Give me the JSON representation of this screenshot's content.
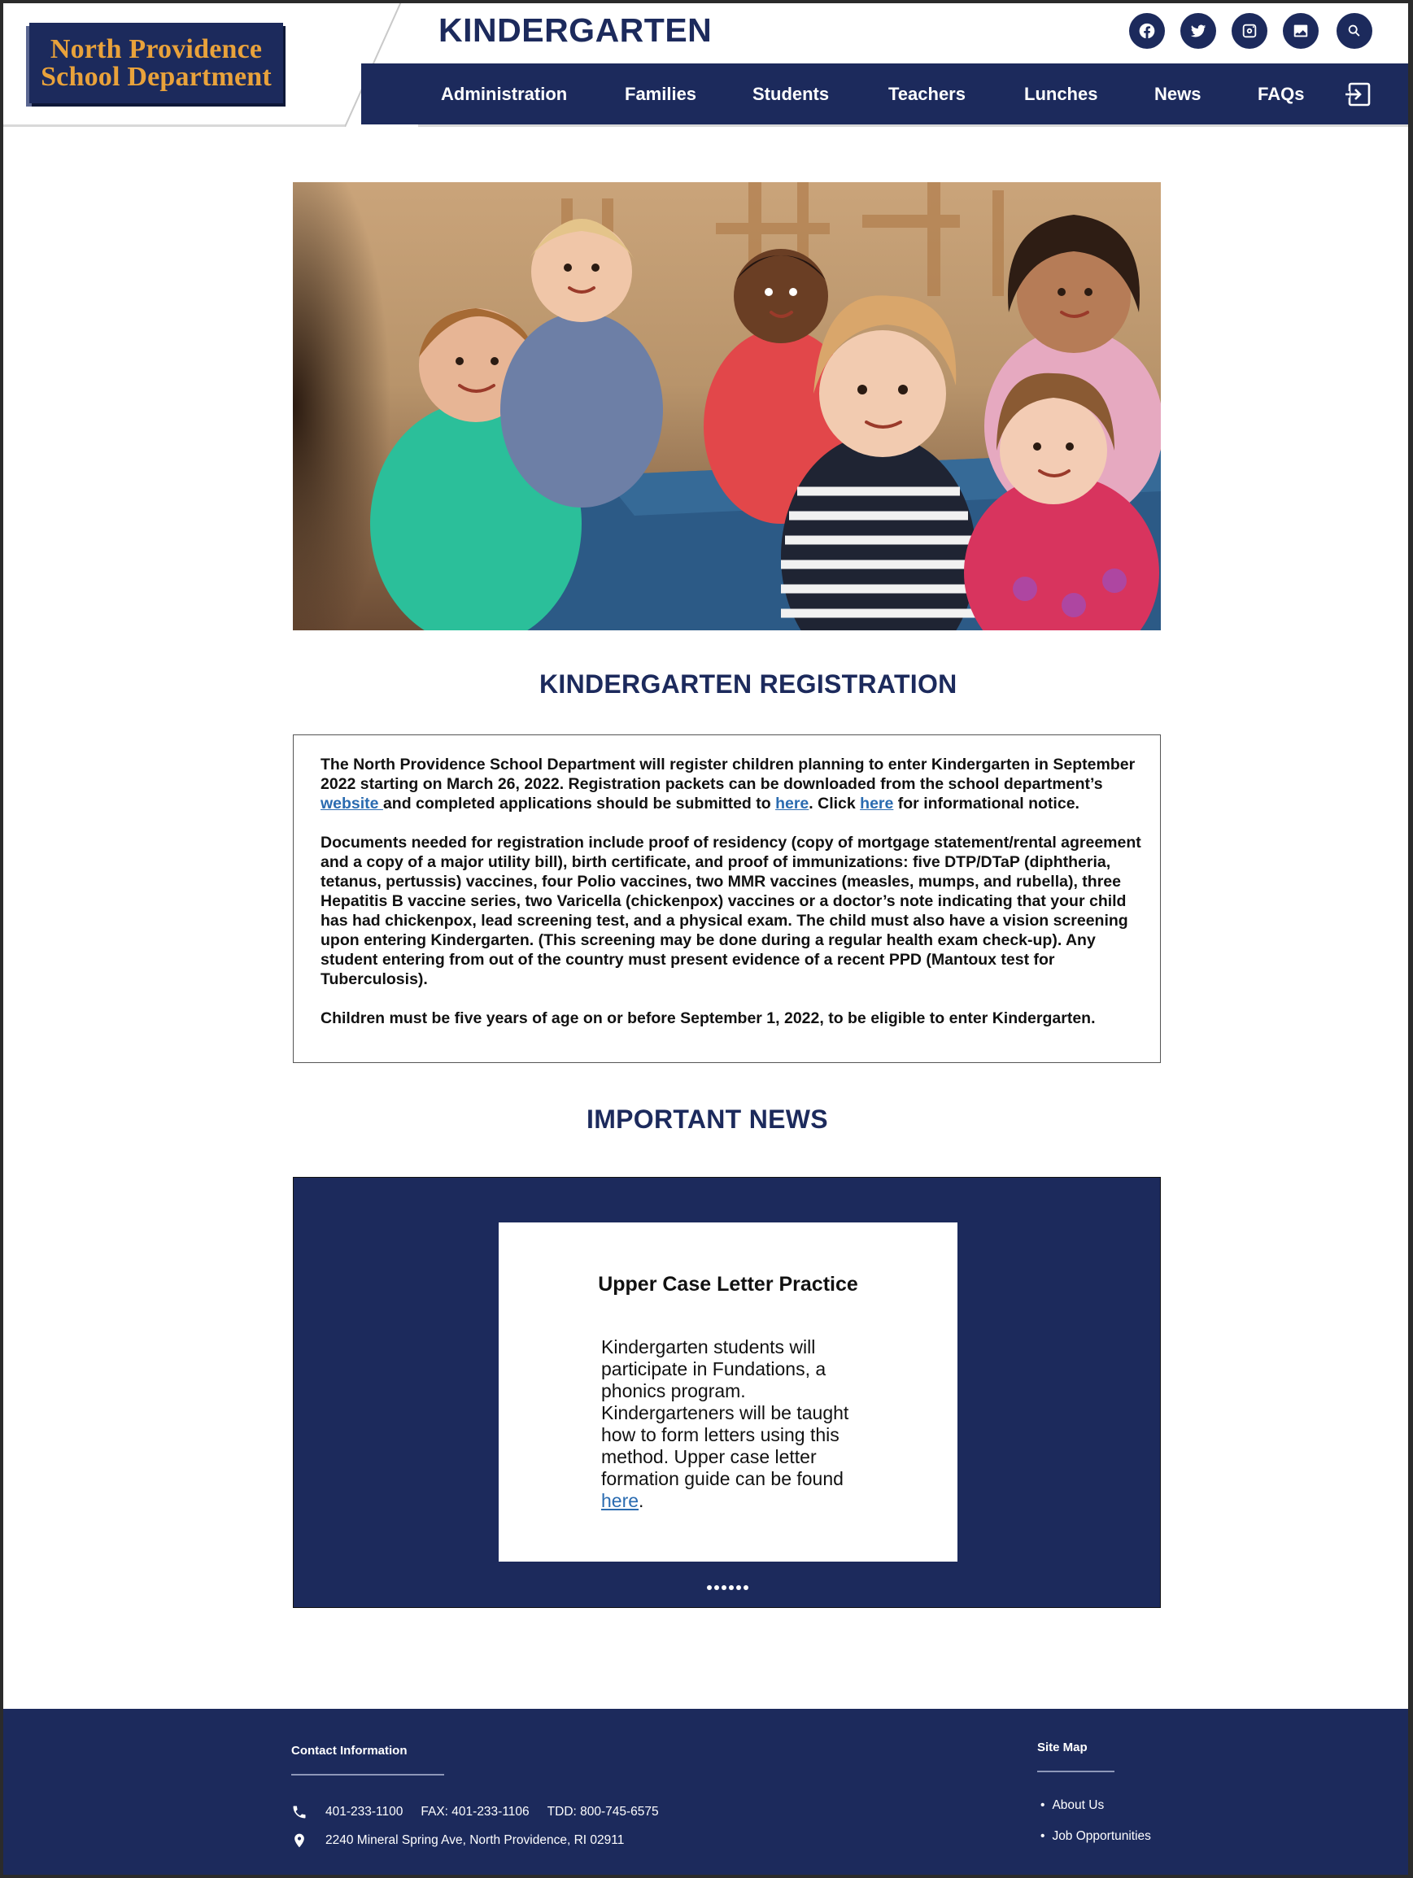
{
  "site": {
    "logo_line1": "North Providence",
    "logo_line2": "School Department",
    "page_title": "KINDERGARTEN",
    "brand_color": "#1c2a5c",
    "accent_color": "#e9a23b",
    "social_icons": [
      "facebook-icon",
      "twitter-icon",
      "instagram-icon",
      "gallery-icon",
      "search-icon"
    ]
  },
  "nav": {
    "items": [
      "Administration",
      "Families",
      "Students",
      "Teachers",
      "Lunches",
      "News",
      "FAQs"
    ],
    "exit_icon": "sign-in-icon"
  },
  "registration": {
    "title": "KINDERGARTEN REGISTRATION",
    "p1_a": "The North Providence School Department will register children planning to enter Kindergarten in September 2022 starting on March 26, 2022. Registration packets can be downloaded from the school department’s ",
    "p1_link1": "website ",
    "p1_b": " and completed applications should be submitted to ",
    "p1_link2": "here",
    "p1_c": ". Click ",
    "p1_link3": "here",
    "p1_d": " for informational notice.",
    "p2": "Documents needed for registration include proof of residency (copy of mortgage statement/rental agreement and a copy of a major utility bill), birth certificate, and proof of immunizations: five DTP/DTaP (diphtheria, tetanus, pertussis) vaccines, four Polio vaccines, two MMR vaccines (measles, mumps, and rubella), three Hepatitis B vaccine series, two Varicella (chickenpox) vaccines or a doctor’s note indicating that your child has had chickenpox, lead screening test, and a physical exam.  The child must also have a vision screening upon entering Kindergarten. (This screening may be done during a regular health exam check-up).  Any student entering from out of the country must present evidence of a recent PPD (Mantoux test for Tuberculosis).",
    "p3": "Children must be five years of age on or before September 1, 2022, to be eligible to enter Kindergarten."
  },
  "news": {
    "title": "IMPORTANT NEWS",
    "card_title": "Upper Case Letter Practice",
    "card_body": "Kindergarten students will participate in Fundations, a phonics program. Kindergarteners will be taught how to form letters using this method. Upper case letter formation guide can be found ",
    "card_link": "here",
    "card_end": ".",
    "slide_count": 6
  },
  "footer": {
    "contact_heading": "Contact Information",
    "phone": "401-233-1100",
    "fax": "FAX: 401-233-1106",
    "tdd": "TDD: 800-745-6575",
    "address": "2240 Mineral Spring Ave, North Providence, RI 02911",
    "sitemap_heading": "Site Map",
    "sitemap_links": [
      "About Us",
      "Job Opportunities"
    ]
  }
}
